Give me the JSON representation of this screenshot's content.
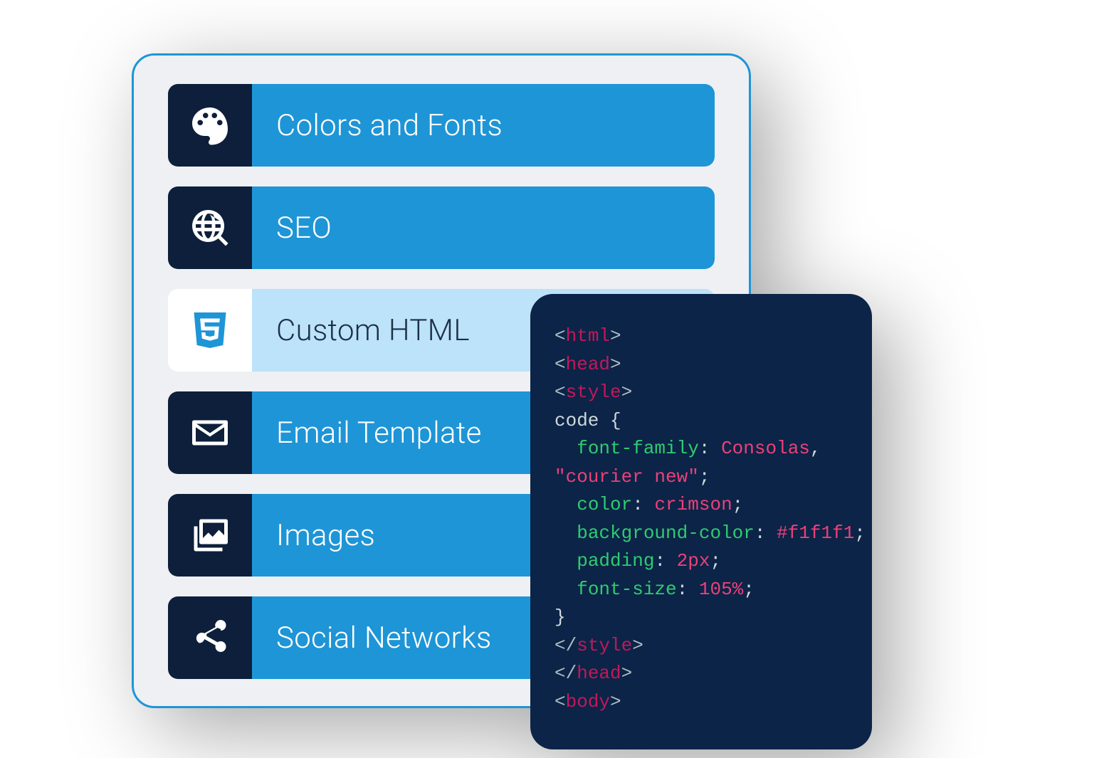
{
  "menu": {
    "items": [
      {
        "id": "colors-fonts",
        "label": "Colors and Fonts",
        "icon": "palette-icon",
        "active": false
      },
      {
        "id": "seo",
        "label": "SEO",
        "icon": "globe-search-icon",
        "active": false
      },
      {
        "id": "custom-html",
        "label": "Custom HTML",
        "icon": "html5-icon",
        "active": true
      },
      {
        "id": "email-template",
        "label": "Email Template",
        "icon": "envelope-icon",
        "active": false
      },
      {
        "id": "images",
        "label": "Images",
        "icon": "images-icon",
        "active": false
      },
      {
        "id": "social-networks",
        "label": "Social Networks",
        "icon": "share-icon",
        "active": false
      }
    ]
  },
  "code": {
    "lines": [
      [
        {
          "t": "b",
          "v": "<"
        },
        {
          "t": "tag",
          "v": "html"
        },
        {
          "t": "b",
          "v": ">"
        }
      ],
      [
        {
          "t": "b",
          "v": "<"
        },
        {
          "t": "tag",
          "v": "head"
        },
        {
          "t": "b",
          "v": ">"
        }
      ],
      [
        {
          "t": "b",
          "v": "<"
        },
        {
          "t": "tag",
          "v": "style"
        },
        {
          "t": "b",
          "v": ">"
        }
      ],
      [
        {
          "t": "sel",
          "v": "code "
        },
        {
          "t": "p",
          "v": "{"
        }
      ],
      [
        {
          "t": "pad",
          "v": "  "
        },
        {
          "t": "prop",
          "v": "font-family"
        },
        {
          "t": "delim",
          "v": ": "
        },
        {
          "t": "val",
          "v": "Consolas"
        },
        {
          "t": "delim",
          "v": ","
        }
      ],
      [
        {
          "t": "val",
          "v": "\"courier new\""
        },
        {
          "t": "delim",
          "v": ";"
        }
      ],
      [
        {
          "t": "pad",
          "v": "  "
        },
        {
          "t": "prop",
          "v": "color"
        },
        {
          "t": "delim",
          "v": ": "
        },
        {
          "t": "val",
          "v": "crimson"
        },
        {
          "t": "delim",
          "v": ";"
        }
      ],
      [
        {
          "t": "pad",
          "v": "  "
        },
        {
          "t": "prop",
          "v": "background-color"
        },
        {
          "t": "delim",
          "v": ": "
        },
        {
          "t": "val",
          "v": "#f1f1f1"
        },
        {
          "t": "delim",
          "v": ";"
        }
      ],
      [
        {
          "t": "pad",
          "v": "  "
        },
        {
          "t": "prop",
          "v": "padding"
        },
        {
          "t": "delim",
          "v": ": "
        },
        {
          "t": "val",
          "v": "2px"
        },
        {
          "t": "delim",
          "v": ";"
        }
      ],
      [
        {
          "t": "pad",
          "v": "  "
        },
        {
          "t": "prop",
          "v": "font-size"
        },
        {
          "t": "delim",
          "v": ": "
        },
        {
          "t": "val",
          "v": "105%"
        },
        {
          "t": "delim",
          "v": ";"
        }
      ],
      [
        {
          "t": "p",
          "v": "}"
        }
      ],
      [
        {
          "t": "b",
          "v": "</"
        },
        {
          "t": "tag",
          "v": "style"
        },
        {
          "t": "b",
          "v": ">"
        }
      ],
      [
        {
          "t": "b",
          "v": "</"
        },
        {
          "t": "tag",
          "v": "head"
        },
        {
          "t": "b",
          "v": ">"
        }
      ],
      [
        {
          "t": "b",
          "v": "<"
        },
        {
          "t": "tag",
          "v": "body"
        },
        {
          "t": "b",
          "v": ">"
        }
      ]
    ]
  },
  "colors": {
    "panel_outline": "#1e95d6",
    "accent": "#1e95d6",
    "navy": "#0b2a52",
    "code_bg": "#0c2447"
  }
}
